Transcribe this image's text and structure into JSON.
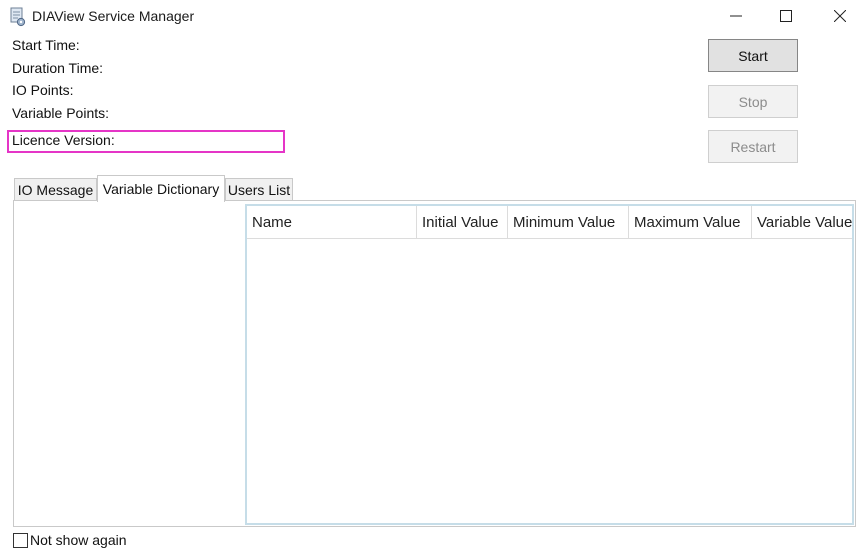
{
  "window": {
    "title": "DIAView Service Manager",
    "icon": "document-gear-icon"
  },
  "info": {
    "start_time_label": "Start Time:",
    "duration_time_label": "Duration Time:",
    "io_points_label": "IO Points:",
    "variable_points_label": "Variable Points:",
    "licence_version_label": "Licence Version:"
  },
  "buttons": {
    "start": "Start",
    "stop": "Stop",
    "restart": "Restart"
  },
  "tabs": [
    {
      "label": "IO Message",
      "active": false
    },
    {
      "label": "Variable Dictionary",
      "active": true
    },
    {
      "label": "Users List",
      "active": false
    }
  ],
  "grid": {
    "columns": [
      "Name",
      "Initial Value",
      "Minimum Value",
      "Maximum Value",
      "Variable Value"
    ],
    "rows": []
  },
  "footer": {
    "not_show_again_label": "Not show again",
    "not_show_again_checked": false
  },
  "colors": {
    "highlight": "#e535c7",
    "grid_border": "#c6dde8"
  }
}
